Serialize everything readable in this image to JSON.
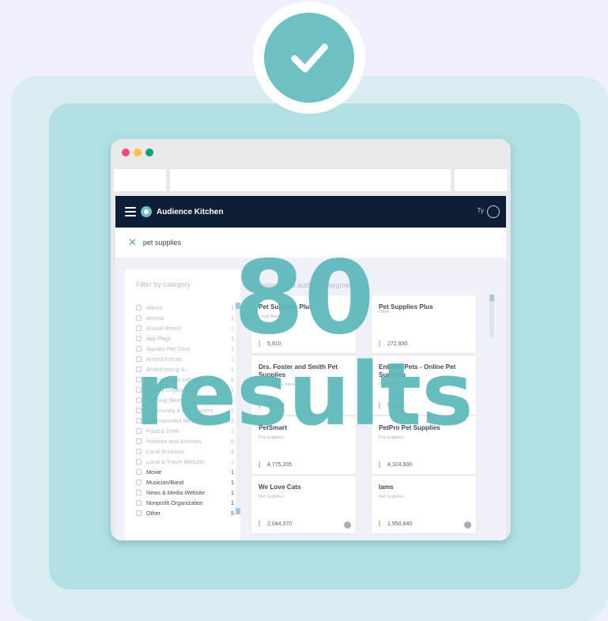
{
  "colors": {
    "accent": "#6ec0c3",
    "navbar": "#0e1e36",
    "dot_red": "#ee4c74",
    "dot_yellow": "#f8c342",
    "dot_green": "#119c7c"
  },
  "icons": {
    "status": "check-icon",
    "menu": "hamburger-icon",
    "logo": "audience-kitchen-logo",
    "clear_search": "close-icon",
    "user": "user-avatar-icon",
    "info": "info-icon"
  },
  "app": {
    "name": "Audience Kitchen",
    "user_initials": "Ty"
  },
  "search": {
    "query": "pet supplies"
  },
  "filter": {
    "title": "Filter by category",
    "items": [
      {
        "label": "Album",
        "count": "1",
        "checked": false,
        "dim": true
      },
      {
        "label": "Animal",
        "count": "1",
        "checked": false,
        "dim": true
      },
      {
        "label": "Animal Breed",
        "count": "1",
        "checked": false,
        "dim": true
      },
      {
        "label": "App Page",
        "count": "1",
        "checked": false,
        "dim": true
      },
      {
        "label": "Aquatic Pet Store",
        "count": "1",
        "checked": false,
        "dim": true
      },
      {
        "label": "Armed Forces",
        "count": "1",
        "checked": false,
        "dim": true
      },
      {
        "label": "Broadcasting &...",
        "count": "1",
        "checked": false,
        "dim": true
      },
      {
        "label": "Business and Industry",
        "count": "6",
        "checked": false,
        "dim": true
      },
      {
        "label": "Charity Organization",
        "count": "1",
        "checked": false,
        "dim": true
      },
      {
        "label": "Clothing (Brand)",
        "count": "1",
        "checked": false,
        "dim": true
      },
      {
        "label": "Community & Government",
        "count": "1",
        "checked": false,
        "dim": true
      },
      {
        "label": "Entertainment Website",
        "count": "1",
        "checked": false,
        "dim": true
      },
      {
        "label": "Food & Drink",
        "count": "1",
        "checked": false,
        "dim": true
      },
      {
        "label": "Hobbies and activities",
        "count": "6",
        "checked": false,
        "dim": true
      },
      {
        "label": "Local Business",
        "count": "4",
        "checked": false,
        "dim": true
      },
      {
        "label": "Local & Travel Website",
        "count": "1",
        "checked": false,
        "dim": true
      },
      {
        "label": "Movie",
        "count": "1",
        "checked": false,
        "dim": false
      },
      {
        "label": "Musician/Band",
        "count": "1",
        "checked": false,
        "dim": false
      },
      {
        "label": "News & Media Website",
        "count": "1",
        "checked": false,
        "dim": false
      },
      {
        "label": "Nonprofit Organization",
        "count": "1",
        "checked": false,
        "dim": false
      },
      {
        "label": "Other",
        "count": "5",
        "checked": false,
        "dim": false
      }
    ]
  },
  "segments": {
    "hint": "Select from audience segments...",
    "cards": [
      {
        "name": "Pet Supplies Plus",
        "type": "Local Business",
        "count": "5,910"
      },
      {
        "name": "Pet Supplies Plus",
        "type": "Other",
        "count": "272,930"
      },
      {
        "name": "Drs. Foster and Smith Pet Supplies",
        "type": "Pet Supplies Store",
        "count": "98,280"
      },
      {
        "name": "Entirely Pets - Online Pet Supplies",
        "type": "Pet Supplies",
        "count": "9,100"
      },
      {
        "name": "PetSmart",
        "type": "Pet Supplies",
        "count": "4,775,205"
      },
      {
        "name": "PetPro Pet Supplies",
        "type": "Pet Supplies",
        "count": "4,324,600"
      },
      {
        "name": "We Love Cats",
        "type": "Pet Supplies",
        "count": "2,044,370"
      },
      {
        "name": "Iams",
        "type": "Pet Supplies",
        "count": "1,950,840"
      }
    ]
  },
  "overlay": {
    "number": "80",
    "word": "results"
  }
}
